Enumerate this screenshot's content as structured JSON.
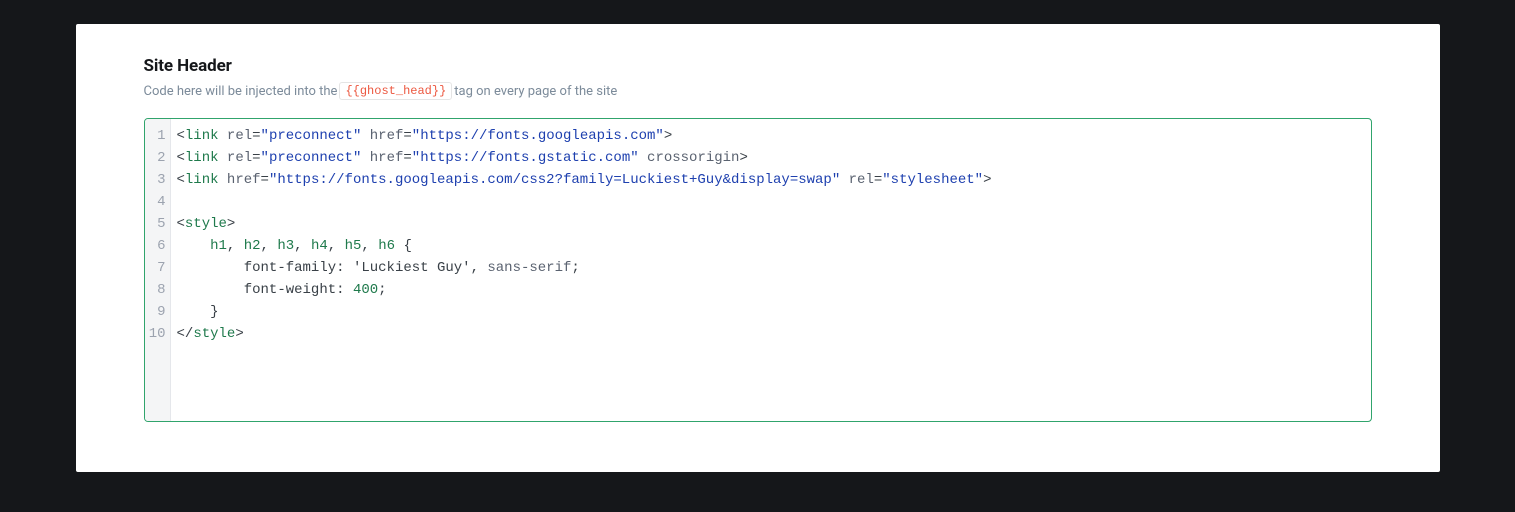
{
  "section": {
    "title": "Site Header",
    "desc_before": "Code here will be injected into the ",
    "desc_code": "{{ghost_head}}",
    "desc_after": " tag on every page of the site"
  },
  "editor": {
    "line_count": 10,
    "lines": [
      "<link rel=\"preconnect\" href=\"https://fonts.googleapis.com\">",
      "<link rel=\"preconnect\" href=\"https://fonts.gstatic.com\" crossorigin>",
      "<link href=\"https://fonts.googleapis.com/css2?family=Luckiest+Guy&display=swap\" rel=\"stylesheet\">",
      "",
      "<style>",
      "    h1, h2, h3, h4, h5, h6 {",
      "        font-family: 'Luckiest Guy', sans-serif;",
      "        font-weight: 400;",
      "    }",
      "</style>"
    ],
    "tokens": [
      [
        [
          "<",
          "t-op"
        ],
        [
          "link",
          "t-tag"
        ],
        [
          " "
        ],
        [
          "rel",
          "t-attr"
        ],
        [
          "=",
          "t-op"
        ],
        [
          "\"preconnect\"",
          "t-str"
        ],
        [
          " "
        ],
        [
          "href",
          "t-attr"
        ],
        [
          "=",
          "t-op"
        ],
        [
          "\"https://fonts.googleapis.com\"",
          "t-str"
        ],
        [
          ">",
          "t-op"
        ]
      ],
      [
        [
          "<",
          "t-op"
        ],
        [
          "link",
          "t-tag"
        ],
        [
          " "
        ],
        [
          "rel",
          "t-attr"
        ],
        [
          "=",
          "t-op"
        ],
        [
          "\"preconnect\"",
          "t-str"
        ],
        [
          " "
        ],
        [
          "href",
          "t-attr"
        ],
        [
          "=",
          "t-op"
        ],
        [
          "\"https://fonts.gstatic.com\"",
          "t-str"
        ],
        [
          " "
        ],
        [
          "crossorigin",
          "t-attr"
        ],
        [
          ">",
          "t-op"
        ]
      ],
      [
        [
          "<",
          "t-op"
        ],
        [
          "link",
          "t-tag"
        ],
        [
          " "
        ],
        [
          "href",
          "t-attr"
        ],
        [
          "=",
          "t-op"
        ],
        [
          "\"https://fonts.googleapis.com/css2?family=Luckiest+Guy&display=swap\"",
          "t-str"
        ],
        [
          " "
        ],
        [
          "rel",
          "t-attr"
        ],
        [
          "=",
          "t-op"
        ],
        [
          "\"stylesheet\"",
          "t-str"
        ],
        [
          ">",
          "t-op"
        ]
      ],
      [],
      [
        [
          "<",
          "t-op"
        ],
        [
          "style",
          "t-tag"
        ],
        [
          ">",
          "t-op"
        ]
      ],
      [
        [
          "    "
        ],
        [
          "h1",
          "t-sel"
        ],
        [
          ", ",
          "t-punc"
        ],
        [
          "h2",
          "t-sel"
        ],
        [
          ", ",
          "t-punc"
        ],
        [
          "h3",
          "t-sel"
        ],
        [
          ", ",
          "t-punc"
        ],
        [
          "h4",
          "t-sel"
        ],
        [
          ", ",
          "t-punc"
        ],
        [
          "h5",
          "t-sel"
        ],
        [
          ", ",
          "t-punc"
        ],
        [
          "h6",
          "t-sel"
        ],
        [
          " { ",
          "t-punc"
        ]
      ],
      [
        [
          "        "
        ],
        [
          "font-family: ",
          "t-prop"
        ],
        [
          "'Luckiest Guy'",
          "t-val"
        ],
        [
          ", ",
          "t-punc"
        ],
        [
          "sans-serif",
          "t-kw"
        ],
        [
          ";",
          "t-punc"
        ]
      ],
      [
        [
          "        "
        ],
        [
          "font-weight: ",
          "t-prop"
        ],
        [
          "400",
          "t-num"
        ],
        [
          ";",
          "t-punc"
        ]
      ],
      [
        [
          "    "
        ],
        [
          "}",
          "t-punc"
        ]
      ],
      [
        [
          "</",
          "t-op"
        ],
        [
          "style",
          "t-tag"
        ],
        [
          ">",
          "t-op"
        ]
      ]
    ]
  },
  "colors": {
    "accent_border": "#30a46c",
    "background": "#15171a"
  }
}
